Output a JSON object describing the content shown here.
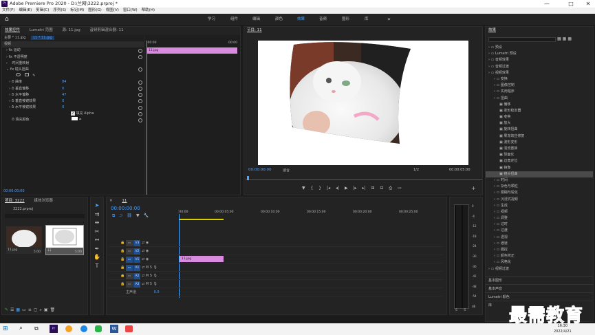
{
  "window": {
    "title": "Adobe Premiere Pro 2020 - D:\\兰网\\3222.prproj *",
    "logo": "Pr",
    "minimize": "—",
    "maximize": "□",
    "close": "✕"
  },
  "menu": [
    "文件(F)",
    "编辑(E)",
    "剪辑(C)",
    "序列(S)",
    "标记(M)",
    "图形(G)",
    "视图(V)",
    "窗口(W)",
    "帮助(H)"
  ],
  "workspaces": {
    "tabs": [
      "学习",
      "组件",
      "编辑",
      "颜色",
      "效果",
      "音频",
      "图形",
      "库"
    ],
    "active": "效果",
    "more": "»"
  },
  "effect_controls": {
    "tabs": [
      "效果控件",
      "Lumetri 范围",
      "源: 11.jpg",
      "音频剪辑混合器: 11"
    ],
    "source": "主要 * 11.jpg",
    "clip": "11 * 11.jpg",
    "section_video": "视频",
    "rows": [
      {
        "label": "运动",
        "value": ""
      },
      {
        "label": "不透明度",
        "value": ""
      },
      {
        "label": "时间重映射",
        "value": ""
      },
      {
        "label": "镜头扭曲",
        "value": ""
      }
    ],
    "params": [
      {
        "label": "曲率",
        "value": "84"
      },
      {
        "label": "垂直偏移",
        "value": "0"
      },
      {
        "label": "水平偏移",
        "value": "47"
      },
      {
        "label": "垂直棱镜效果",
        "value": "0"
      },
      {
        "label": "水平棱镜效果",
        "value": "0"
      }
    ],
    "fill_alpha": "填充 Alpha",
    "fill_color": "填充颜色",
    "timecode": "00:00:00:00",
    "mini_time_start": ":00:00",
    "mini_time_end": "00:00",
    "mini_clip": "11.jpg"
  },
  "program": {
    "tab": "节目: 11",
    "timecode": "00:00:00:00",
    "fit": "适合",
    "ratio": "1/2",
    "duration": "00:00:05:00",
    "buttons": [
      "▼",
      "{",
      "}",
      "|◂",
      "◂|",
      "▶",
      "|▸",
      "▸|",
      "⊞",
      "⊟",
      "⎙",
      "▭",
      "+"
    ]
  },
  "effects_panel": {
    "tab": "效果",
    "search_placeholder": "",
    "tree": [
      {
        "label": "预设",
        "level": 0
      },
      {
        "label": "Lumetri 预设",
        "level": 0
      },
      {
        "label": "音频效果",
        "level": 0
      },
      {
        "label": "音频过渡",
        "level": 0
      },
      {
        "label": "视频效果",
        "level": 0
      },
      {
        "label": "变换",
        "level": 1
      },
      {
        "label": "图像控制",
        "level": 1
      },
      {
        "label": "实用程序",
        "level": 1
      },
      {
        "label": "扭曲",
        "level": 1
      },
      {
        "label": "偏移",
        "level": 2
      },
      {
        "label": "变形稳定器",
        "level": 2
      },
      {
        "label": "变换",
        "level": 2
      },
      {
        "label": "放大",
        "level": 2
      },
      {
        "label": "旋转扭曲",
        "level": 2
      },
      {
        "label": "果冻效应修复",
        "level": 2
      },
      {
        "label": "波形变形",
        "level": 2
      },
      {
        "label": "湍流置换",
        "level": 2
      },
      {
        "label": "球面化",
        "level": 2
      },
      {
        "label": "边角定位",
        "level": 2
      },
      {
        "label": "镜像",
        "level": 2
      },
      {
        "label": "镜头扭曲",
        "level": 2,
        "selected": true
      },
      {
        "label": "时间",
        "level": 1
      },
      {
        "label": "杂色与颗粒",
        "level": 1
      },
      {
        "label": "模糊与锐化",
        "level": 1
      },
      {
        "label": "沉浸式视频",
        "level": 1
      },
      {
        "label": "生成",
        "level": 1
      },
      {
        "label": "视频",
        "level": 1
      },
      {
        "label": "调整",
        "level": 1
      },
      {
        "label": "过时",
        "level": 1
      },
      {
        "label": "过渡",
        "level": 1
      },
      {
        "label": "透视",
        "level": 1
      },
      {
        "label": "通道",
        "level": 1
      },
      {
        "label": "键控",
        "level": 1
      },
      {
        "label": "颜色校正",
        "level": 1
      },
      {
        "label": "风格化",
        "level": 1
      },
      {
        "label": "视频过渡",
        "level": 0
      }
    ],
    "bottom": [
      "基本图形",
      "基本声音",
      "Lumetri 颜色",
      "库"
    ]
  },
  "project": {
    "tabs": [
      "项目: 3222",
      "媒体浏览器"
    ],
    "file": "3222.prproj",
    "items": [
      {
        "name": "11.jpg",
        "duration": "5:00"
      },
      {
        "name": "11",
        "duration": "5:00"
      }
    ]
  },
  "timeline": {
    "tab": "11",
    "timecode": "00:00:00:00",
    "ruler": [
      ":00:00",
      "00:00:05:00",
      "00:00:10:00",
      "00:00:15:00",
      "00:00:20:00",
      "00:00:25:00"
    ],
    "video_tracks": [
      "V3",
      "V2",
      "V1"
    ],
    "audio_tracks": [
      "A1",
      "A2",
      "A3"
    ],
    "master": "主声道",
    "master_value": "0.0",
    "clip": "11.jpg"
  },
  "meter": {
    "scale": [
      "0",
      "-6",
      "-12",
      "-18",
      "-24",
      "-30",
      "-36",
      "-42",
      "-48",
      "-54",
      "dB"
    ],
    "bottom": [
      "S",
      "S"
    ]
  },
  "watermark": "最需教育",
  "taskbar": {
    "time": "16:30",
    "date": "2022/4/21"
  },
  "colors": {
    "accent": "#4aa8ff",
    "clip": "#d98be0",
    "panel": "#232323"
  }
}
